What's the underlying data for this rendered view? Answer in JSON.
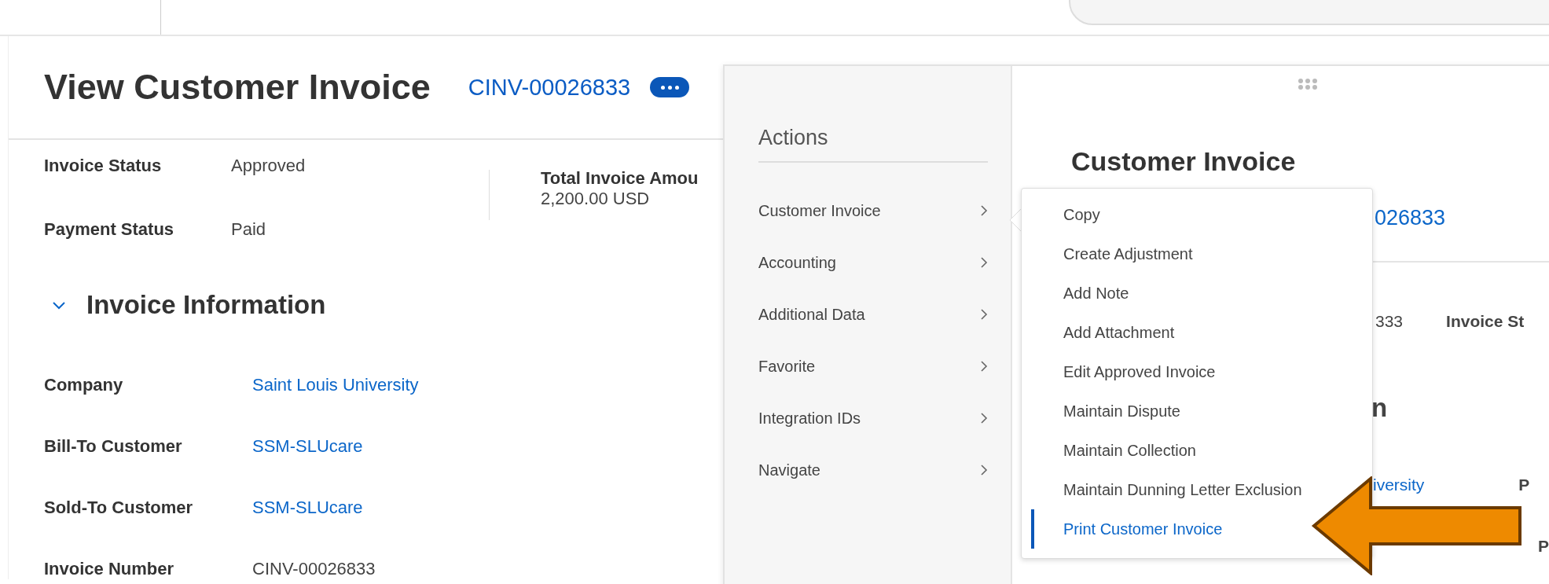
{
  "page": {
    "title": "View Customer Invoice",
    "invoice_id": "CINV-00026833"
  },
  "summary": [
    {
      "label": "Invoice Status",
      "value": "Approved"
    },
    {
      "label": "Payment Status",
      "value": "Paid"
    }
  ],
  "total": {
    "label": "Total Invoice Amou",
    "value": "2,200.00 USD"
  },
  "section": {
    "title": "Invoice Information",
    "expanded": true,
    "fields": [
      {
        "label": "Company",
        "value": "Saint Louis University",
        "link": true
      },
      {
        "label": "Bill-To Customer",
        "value": "SSM-SLUcare",
        "link": true
      },
      {
        "label": "Sold-To Customer",
        "value": "SSM-SLUcare",
        "link": true
      },
      {
        "label": "Invoice Number",
        "value": "CINV-00026833",
        "link": false
      }
    ]
  },
  "actions_menu": {
    "title": "Actions",
    "items": [
      {
        "label": "Customer Invoice"
      },
      {
        "label": "Accounting"
      },
      {
        "label": "Additional Data"
      },
      {
        "label": "Favorite"
      },
      {
        "label": "Integration IDs"
      },
      {
        "label": "Navigate"
      }
    ]
  },
  "submenu": {
    "items": [
      {
        "label": "Copy",
        "selected": false
      },
      {
        "label": "Create Adjustment",
        "selected": false
      },
      {
        "label": "Add Note",
        "selected": false
      },
      {
        "label": "Add Attachment",
        "selected": false
      },
      {
        "label": "Edit Approved Invoice",
        "selected": false
      },
      {
        "label": "Maintain Dispute",
        "selected": false
      },
      {
        "label": "Maintain Collection",
        "selected": false
      },
      {
        "label": "Maintain Dunning Letter Exclusion",
        "selected": false
      },
      {
        "label": "Print Customer Invoice",
        "selected": true
      }
    ]
  },
  "preview": {
    "title": "Customer Invoice",
    "id_fragment": "026833",
    "row_value_fragment": "333",
    "row_label_fragment": "Invoice St",
    "heading_fragment": "n",
    "link_fragment": "iversity",
    "side_labels": [
      "P",
      "P"
    ]
  }
}
